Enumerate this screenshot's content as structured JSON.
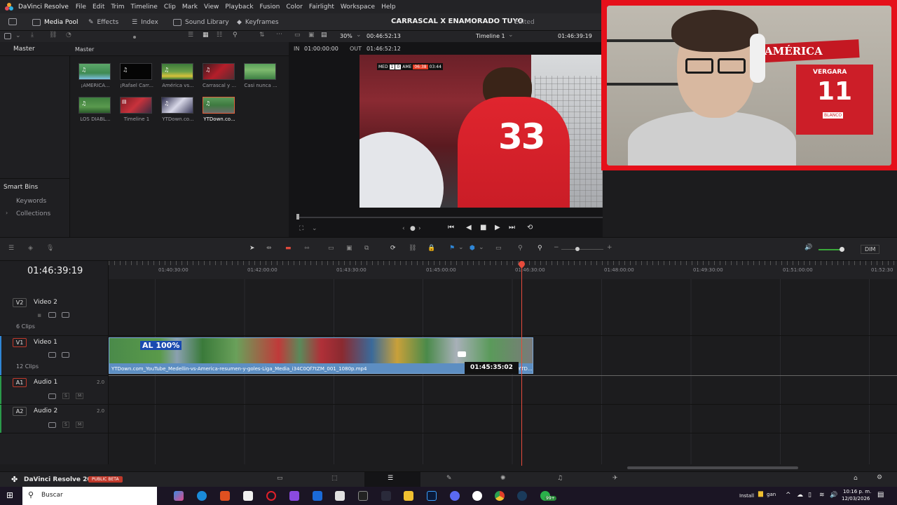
{
  "menubar": {
    "app_title": "DaVinci Resolve",
    "items": [
      "File",
      "Edit",
      "Trim",
      "Timeline",
      "Clip",
      "Mark",
      "View",
      "Playback",
      "Fusion",
      "Color",
      "Fairlight",
      "Workspace",
      "Help"
    ]
  },
  "toolbar": {
    "media_pool": "Media Pool",
    "effects": "Effects",
    "index": "Index",
    "sound_library": "Sound Library",
    "keyframes": "Keyframes",
    "project_title": "CARRASCAL X ENAMORADO TUYO",
    "edited": "Edited"
  },
  "viewer": {
    "zoom": "30%",
    "duration": "00:46:52:13",
    "timeline_name": "Timeline 1",
    "timecode": "01:46:39:19",
    "in_label": "IN",
    "in_value": "01:00:00:00",
    "out_label": "OUT",
    "out_value": "01:46:52:12",
    "score": {
      "home": "MED",
      "home_goals": "1",
      "away_goals": "0",
      "away": "AME",
      "clock": "06:38",
      "period": "03:44"
    },
    "jersey_number": "33"
  },
  "media": {
    "master_sidebar": "Master",
    "master_header": "Master",
    "clips": [
      {
        "label": "¡AMERICA..."
      },
      {
        "label": "¡Rafael Carr..."
      },
      {
        "label": "América vs..."
      },
      {
        "label": "Carrascal y ..."
      },
      {
        "label": "Casi nunca ..."
      },
      {
        "label": "LOS DIABL..."
      },
      {
        "label": "Timeline 1"
      },
      {
        "label": "YTDown.co..."
      },
      {
        "label": "YTDown.co..."
      }
    ],
    "smart_bins": "Smart Bins",
    "keywords": "Keywords",
    "collections": "Collections"
  },
  "webcam": {
    "banner_text": "AMÉRICA",
    "jersey_name": "VERGARA",
    "jersey_number": "11",
    "jersey_brand": "BLANCO"
  },
  "timeline": {
    "timecode": "01:46:39:19",
    "ruler_ticks": [
      "01:40:30:00",
      "01:42:00:00",
      "01:43:30:00",
      "01:45:00:00",
      "01:46:30:00",
      "01:48:00:00",
      "01:49:30:00",
      "01:51:00:00",
      "01:52:30"
    ],
    "tracks": [
      {
        "code": "V2",
        "name": "Video 2",
        "clips": "6 Clips"
      },
      {
        "code": "V1",
        "name": "Video 1",
        "clips": "12 Clips"
      },
      {
        "code": "A1",
        "name": "Audio 1",
        "level": "2.0"
      },
      {
        "code": "A2",
        "name": "Audio 2",
        "level": "2.0"
      }
    ],
    "clip_name": "YTDown.com_YouTube_Medellin-vs-America-resumen-y-goles-Liga_Media_i34C0Qf7tZM_001_1080p.mp4",
    "clip_overlay_text": "AL 100%",
    "clip_tail": "YTD...",
    "hover_timecode": "01:45:35:02",
    "dim_label": "DIM",
    "solo": "S",
    "mute": "M"
  },
  "bottom": {
    "product": "DaVinci Resolve 20",
    "badge": "PUBLIC BETA"
  },
  "taskbar": {
    "search_placeholder": "Buscar",
    "install": "Install",
    "gan": "gan",
    "time": "10:16 p. m.",
    "date": "12/03/2026",
    "whatsapp_badge": "99+"
  },
  "colors": {
    "accent_red": "#e5101a",
    "playhead": "#e64b3c",
    "clip_blue": "#5d8ec2",
    "active_track": "#2f86d6"
  }
}
